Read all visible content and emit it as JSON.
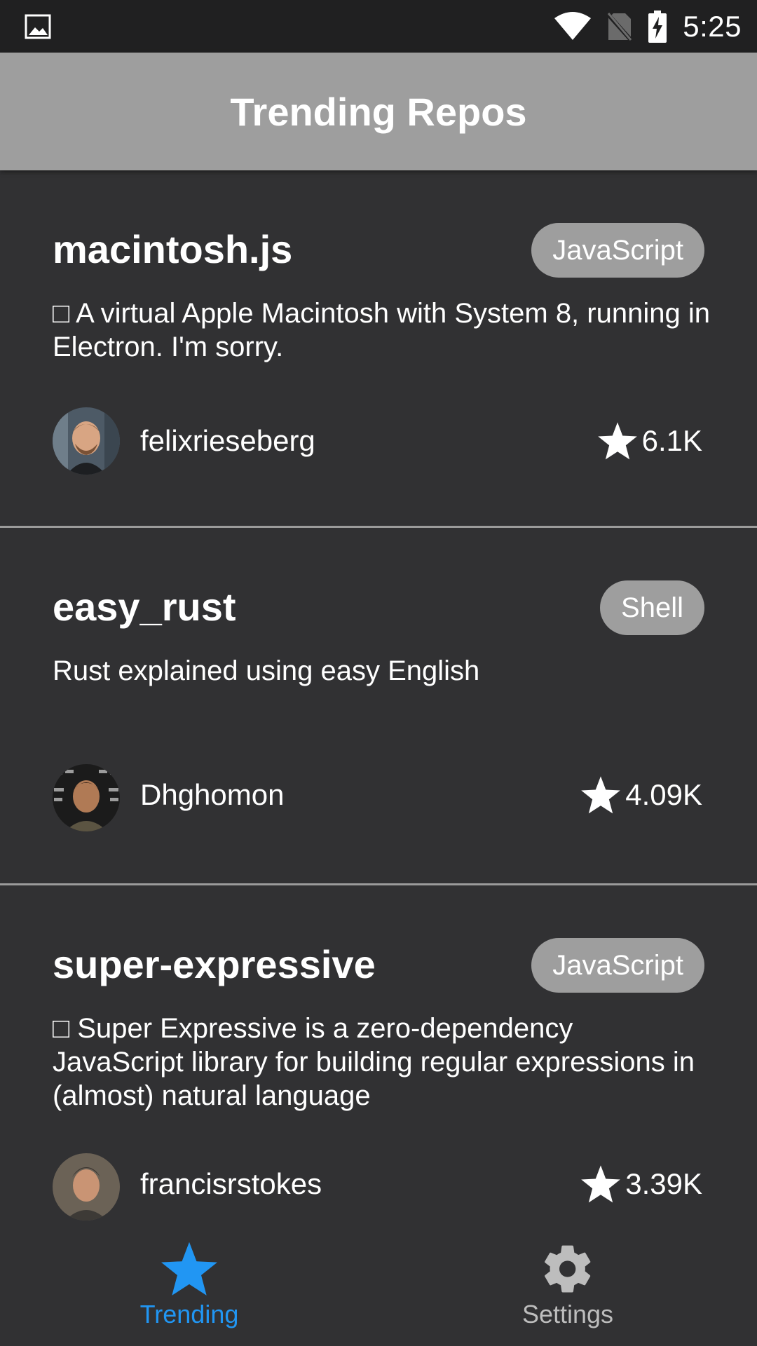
{
  "status_bar": {
    "time": "5:25",
    "icons": [
      "image-icon",
      "wifi-icon",
      "no-sim-icon",
      "battery-charging-icon"
    ]
  },
  "app_bar": {
    "title": "Trending Repos"
  },
  "repos": [
    {
      "name": "macintosh.js",
      "language": "JavaScript",
      "description": "□ A virtual Apple Macintosh with System 8, running in Electron. I'm sorry.",
      "owner": "felixrieseberg",
      "stars": "6.1K"
    },
    {
      "name": "easy_rust",
      "language": "Shell",
      "description": "Rust explained using easy English",
      "owner": "Dhghomon",
      "stars": "4.09K"
    },
    {
      "name": "super-expressive",
      "language": "JavaScript",
      "description": "□ Super Expressive is a zero-dependency JavaScript library for building regular expressions in (almost) natural language",
      "owner": "francisrstokes",
      "stars": "3.39K"
    }
  ],
  "bottom_nav": {
    "items": [
      {
        "label": "Trending",
        "icon": "star-icon",
        "active": true
      },
      {
        "label": "Settings",
        "icon": "gear-icon",
        "active": false
      }
    ],
    "active_color": "#2196f3",
    "inactive_color": "#bdbdbd"
  },
  "colors": {
    "background": "#313133",
    "app_bar": "#9e9e9e",
    "badge": "#9e9e9e"
  }
}
